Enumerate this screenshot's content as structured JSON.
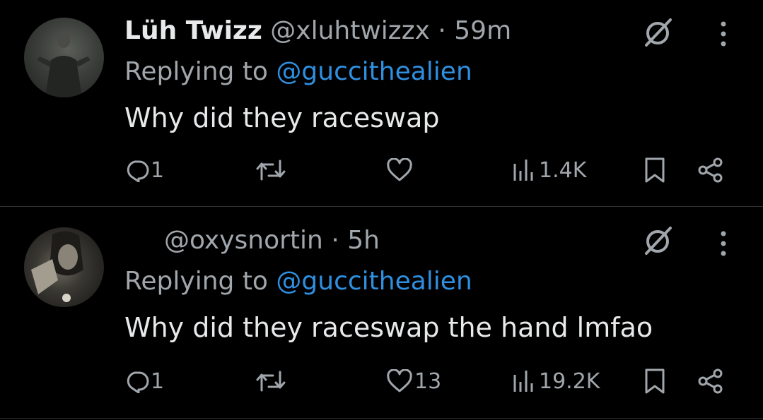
{
  "tweets": [
    {
      "name": "Lüh Twizz",
      "handle": "@xluhtwizzx",
      "separator": "·",
      "time": "59m",
      "replying_prefix": "Replying to ",
      "replying_to": "@guccithealien",
      "text": "Why did they raceswap",
      "replies": "1",
      "reposts": "",
      "likes": "",
      "views": "1.4K"
    },
    {
      "name": "",
      "handle": "@oxysnortin",
      "separator": "·",
      "time": "5h",
      "replying_prefix": "Replying to ",
      "replying_to": "@guccithealien",
      "text": "Why did they raceswap the hand lmfao",
      "replies": "1",
      "reposts": "",
      "likes": "13",
      "views": "19.2K"
    }
  ],
  "colors": {
    "background": "#000000",
    "primary_text": "#e7e9ea",
    "secondary_text": "#a0a6ab",
    "accent": "#2f8fe0",
    "divider": "#2f3336"
  },
  "icons": [
    "reply-icon",
    "repost-icon",
    "like-icon",
    "views-icon",
    "bookmark-icon",
    "share-icon",
    "grok-icon",
    "more-icon"
  ]
}
